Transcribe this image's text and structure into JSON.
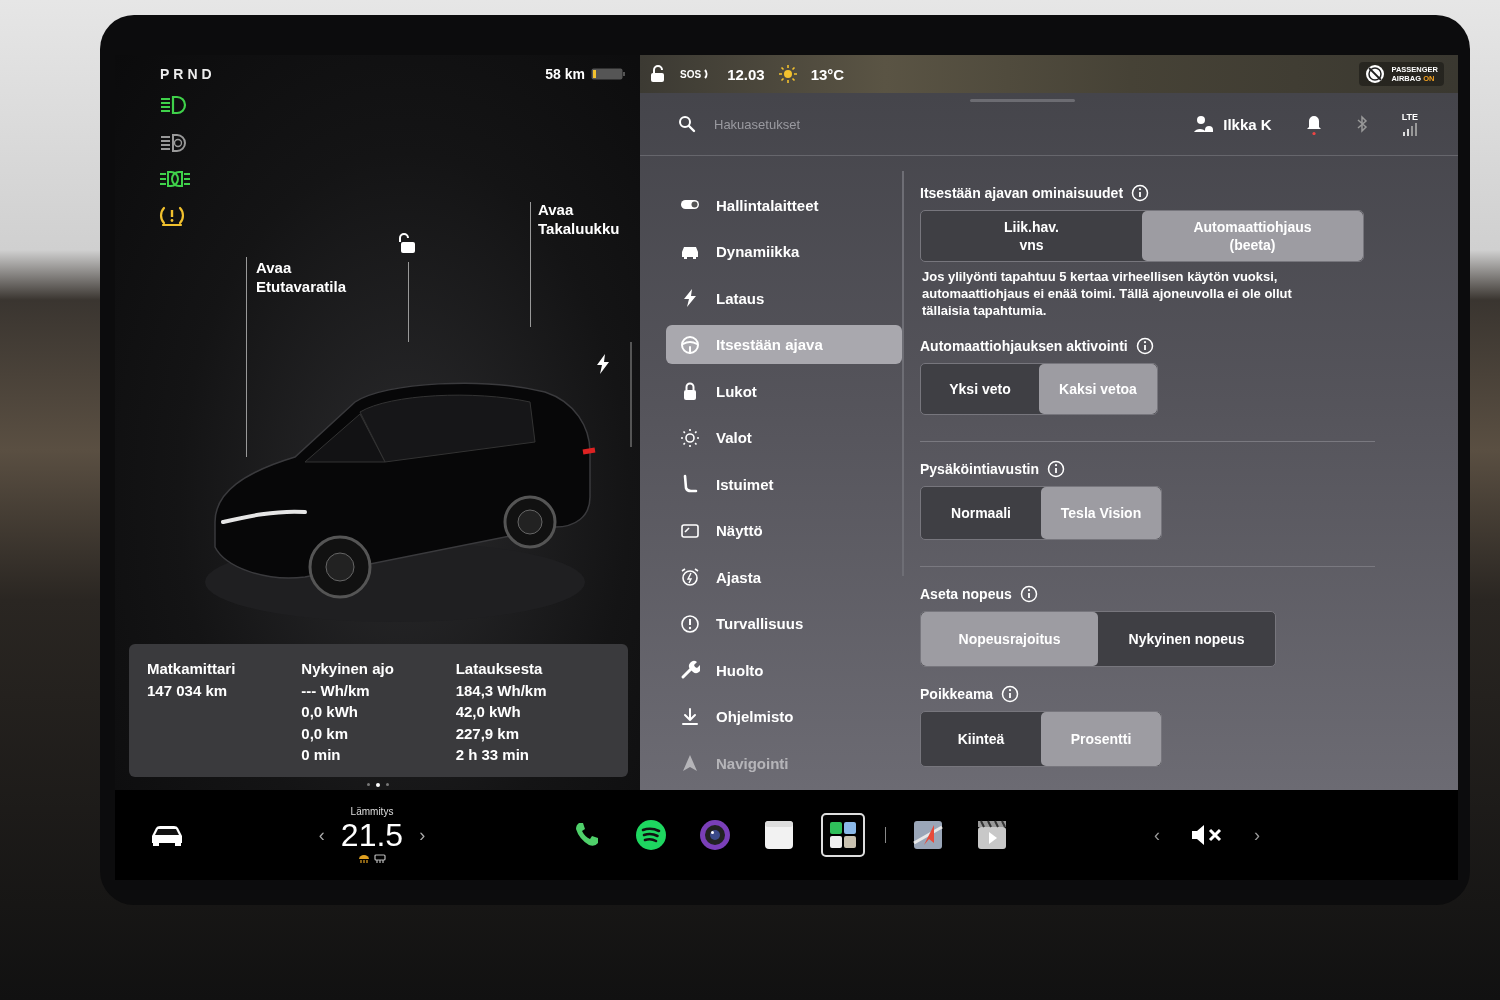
{
  "left": {
    "gear": "PRND",
    "range": "58 km",
    "callouts": [
      {
        "lines": [
          "Avaa",
          "Etutavaratila"
        ]
      },
      {
        "lines": [
          "Avaa",
          "Takaluukku"
        ]
      }
    ],
    "stats": [
      {
        "title": "Matkamittari",
        "lines": [
          "147 034 km"
        ]
      },
      {
        "title": "Nykyinen ajo",
        "lines": [
          "--- Wh/km",
          "0,0 kWh",
          "0,0 km",
          "0 min"
        ]
      },
      {
        "title": "Latauksesta",
        "lines": [
          "184,3 Wh/km",
          "42,0 kWh",
          "227,9 km",
          "2 h 33 min"
        ]
      }
    ],
    "pages": [
      {
        "selected": false
      },
      {
        "selected": true
      },
      {
        "selected": false
      }
    ]
  },
  "status_bar": {
    "sos": "SOS",
    "time": "12.03",
    "temperature": "13°C",
    "airbag": {
      "line1": "PASSENGER",
      "line2": "AIRBAG",
      "state": "ON"
    }
  },
  "header": {
    "search": {
      "placeholder": "Hakuasetukset"
    },
    "user": "Ilkka K",
    "network": "LTE"
  },
  "menu": [
    {
      "label": "Hallintalaitteet",
      "selected": false
    },
    {
      "label": "Dynamiikka",
      "selected": false
    },
    {
      "label": "Lataus",
      "selected": false
    },
    {
      "label": "Itsestään ajava",
      "selected": true
    },
    {
      "label": "Lukot",
      "selected": false
    },
    {
      "label": "Valot",
      "selected": false
    },
    {
      "label": "Istuimet",
      "selected": false
    },
    {
      "label": "Näyttö",
      "selected": false
    },
    {
      "label": "Ajasta",
      "selected": false
    },
    {
      "label": "Turvallisuus",
      "selected": false
    },
    {
      "label": "Huolto",
      "selected": false
    },
    {
      "label": "Ohjelmisto",
      "selected": false
    },
    {
      "label": "Navigointi",
      "selected": false
    }
  ],
  "sections": [
    {
      "title": "Itsestään ajavan ominaisuudet",
      "options": [
        {
          "label": "Liik.hav.\nvns",
          "selected": false
        },
        {
          "label": "Automaattiohjaus\n(beeta)",
          "selected": true
        }
      ],
      "note": "Jos ylilyönti tapahtuu 5 kertaa virheellisen käytön vuoksi, automaattiohjaus ei enää toimi. Tällä ajoneuvolla ei ole ollut tällaisia tapahtumia.",
      "divider_after": false
    },
    {
      "title": "Automaattiohjauksen aktivointi",
      "options": [
        {
          "label": "Yksi veto",
          "selected": false
        },
        {
          "label": "Kaksi vetoa",
          "selected": true
        }
      ],
      "divider_after": true
    },
    {
      "title": "Pysäköintiavustin",
      "options": [
        {
          "label": "Normaali",
          "selected": false
        },
        {
          "label": "Tesla Vision",
          "selected": true
        }
      ],
      "divider_after": true
    },
    {
      "title": "Aseta nopeus",
      "options": [
        {
          "label": "Nopeusrajoitus",
          "selected": true
        },
        {
          "label": "Nykyinen nopeus",
          "selected": false
        }
      ],
      "divider_after": false
    },
    {
      "title": "Poikkeama",
      "options": [
        {
          "label": "Kiinteä",
          "selected": false
        },
        {
          "label": "Prosentti",
          "selected": true
        }
      ],
      "divider_after": false
    }
  ],
  "taskbar": {
    "climate": {
      "label": "Lämmitys",
      "temperature": "21.5",
      "down": "‹",
      "up": "›"
    },
    "apps": [
      {
        "selected": false
      },
      {
        "selected": false
      },
      {
        "selected": false
      },
      {
        "selected": false
      },
      {
        "selected": true
      },
      {
        "selected": false
      },
      {
        "selected": false
      }
    ],
    "volume": {
      "down": "‹",
      "up": "›"
    }
  }
}
